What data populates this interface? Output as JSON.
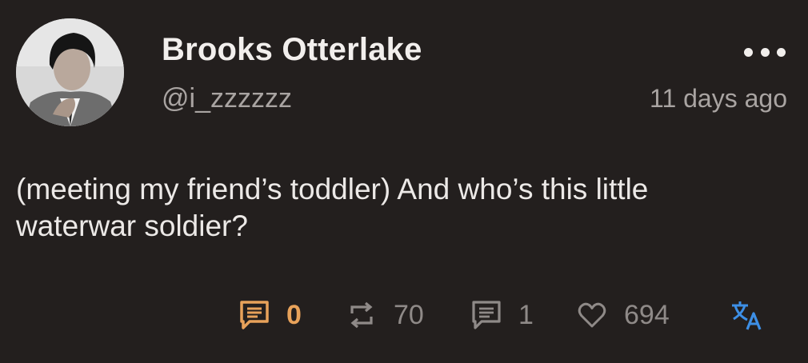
{
  "post": {
    "author": {
      "display_name": "Brooks Otterlake",
      "handle": "@i_zzzzzz"
    },
    "timestamp": "11 days ago",
    "body_line1": "(meeting my friend’s toddler) And who’s this little",
    "body_line2": "waterwar soldier?"
  },
  "actions": {
    "quote_count": "0",
    "boost_count": "70",
    "reply_count": "1",
    "like_count": "694"
  },
  "icons": {
    "more": "more-horizontal-icon",
    "quote": "comment-lines-icon",
    "boost": "repost-icon",
    "reply": "comment-lines-icon",
    "like": "heart-icon",
    "translate": "translate-icon"
  },
  "colors": {
    "background": "#231f1e",
    "accent_active": "#e8a25a",
    "muted": "#8f8a88",
    "translate": "#3d8fe6"
  }
}
